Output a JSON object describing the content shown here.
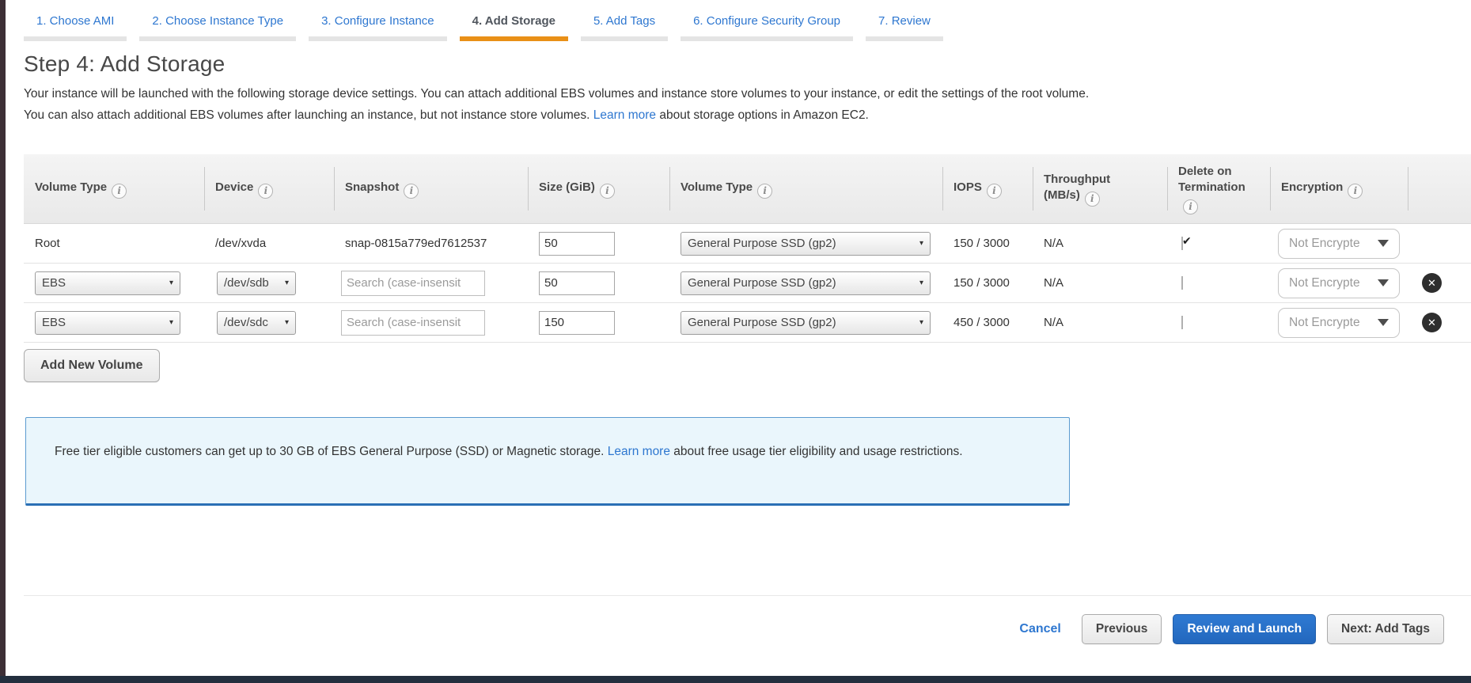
{
  "colors": {
    "accent_orange": "#e99017",
    "link_blue": "#2e77d0",
    "primary_button_blue": "#2a70c8",
    "footer_navy": "#232f3e"
  },
  "tabs": [
    {
      "label": "1. Choose AMI",
      "active": false
    },
    {
      "label": "2. Choose Instance Type",
      "active": false
    },
    {
      "label": "3. Configure Instance",
      "active": false
    },
    {
      "label": "4. Add Storage",
      "active": true
    },
    {
      "label": "5. Add Tags",
      "active": false
    },
    {
      "label": "6. Configure Security Group",
      "active": false
    },
    {
      "label": "7. Review",
      "active": false
    }
  ],
  "step": {
    "title": "Step 4: Add Storage",
    "description_before": "Your instance will be launched with the following storage device settings. You can attach additional EBS volumes and instance store volumes to your instance, or edit the settings of the root volume. You can also attach additional EBS volumes after launching an instance, but not instance store volumes. ",
    "description_link": "Learn more",
    "description_after": " about storage options in Amazon EC2."
  },
  "table": {
    "headers": [
      "Volume Type",
      "Device",
      "Snapshot",
      "Size (GiB)",
      "Volume Type",
      "IOPS",
      "Throughput (MB/s)",
      "Delete on Termination",
      "Encryption"
    ],
    "info_icon_glyph": "i",
    "rows": [
      {
        "volume_type": "Root",
        "device": "/dev/xvda",
        "snapshot": "snap-0815a779ed7612537",
        "size": "50",
        "type_selected": "General Purpose SSD (gp2)",
        "iops": "150 / 3000",
        "throughput": "N/A",
        "delete_on_termination": true,
        "encryption_selected": "Not Encrypte",
        "removable": false
      },
      {
        "volume_type": "EBS",
        "device": "/dev/sdb",
        "snapshot_placeholder": "Search (case-insensit",
        "size": "50",
        "type_selected": "General Purpose SSD (gp2)",
        "iops": "150 / 3000",
        "throughput": "N/A",
        "delete_on_termination": false,
        "encryption_selected": "Not Encrypte",
        "removable": true
      },
      {
        "volume_type": "EBS",
        "device": "/dev/sdc",
        "snapshot_placeholder": "Search (case-insensit",
        "size": "150",
        "type_selected": "General Purpose SSD (gp2)",
        "iops": "450 / 3000",
        "throughput": "N/A",
        "delete_on_termination": false,
        "encryption_selected": "Not Encrypte",
        "removable": true
      }
    ]
  },
  "add_new_volume_label": "Add New Volume",
  "free_tier": {
    "text_before": "Free tier eligible customers can get up to 30 GB of EBS General Purpose (SSD) or Magnetic storage. ",
    "link": "Learn more",
    "text_after": " about free usage tier eligibility and usage restrictions."
  },
  "footer": {
    "cancel_label": "Cancel",
    "previous_label": "Previous",
    "review_and_launch_label": "Review and Launch",
    "next_label": "Next: Add Tags"
  },
  "glyphs": {
    "select_caret": "▾",
    "delete_x": "✕"
  }
}
